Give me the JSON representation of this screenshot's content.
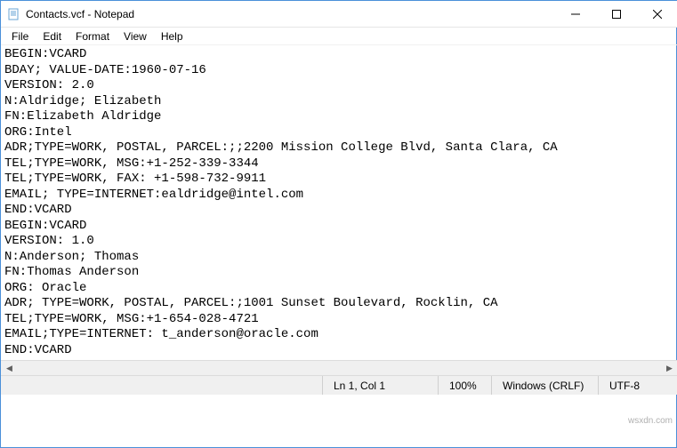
{
  "window": {
    "title": "Contacts.vcf - Notepad"
  },
  "menu": {
    "file": "File",
    "edit": "Edit",
    "format": "Format",
    "view": "View",
    "help": "Help"
  },
  "content": "BEGIN:VCARD\nBDAY; VALUE-DATE:1960-07-16\nVERSION: 2.0\nN:Aldridge; Elizabeth\nFN:Elizabeth Aldridge\nORG:Intel\nADR;TYPE=WORK, POSTAL, PARCEL:;;2200 Mission College Blvd, Santa Clara, CA\nTEL;TYPE=WORK, MSG:+1-252-339-3344\nTEL;TYPE=WORK, FAX: +1-598-732-9911\nEMAIL; TYPE=INTERNET:ealdridge@intel.com\nEND:VCARD\nBEGIN:VCARD\nVERSION: 1.0\nN:Anderson; Thomas\nFN:Thomas Anderson\nORG: Oracle\nADR; TYPE=WORK, POSTAL, PARCEL:;1001 Sunset Boulevard, Rocklin, CA\nTEL;TYPE=WORK, MSG:+1-654-028-4721\nEMAIL;TYPE=INTERNET: t_anderson@oracle.com\nEND:VCARD",
  "status": {
    "position": "Ln 1, Col 1",
    "zoom": "100%",
    "line_ending": "Windows (CRLF)",
    "encoding": "UTF-8"
  },
  "watermark": "wsxdn.com"
}
